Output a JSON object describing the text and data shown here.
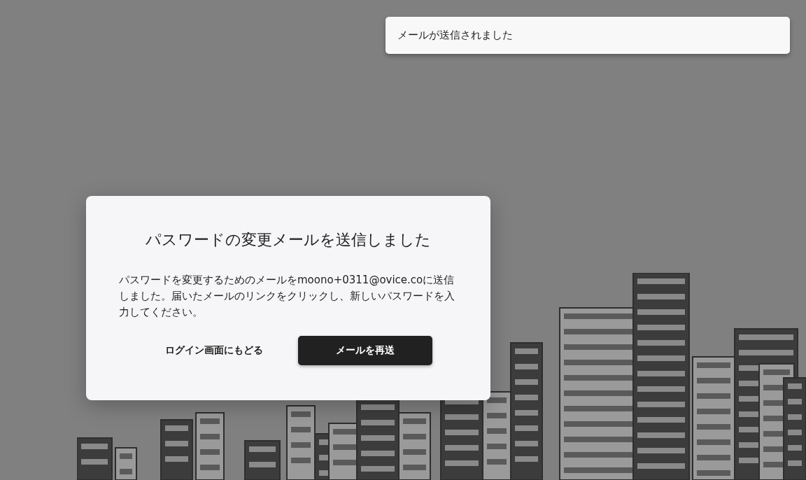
{
  "toast": {
    "message": "メールが送信されました"
  },
  "dialog": {
    "title": "パスワードの変更メールを送信しました",
    "body": "パスワードを変更するためのメールをmoono+0311@ovice.coに送信しました。届いたメールのリンクをクリックし、新しいパスワードを入力してください。",
    "buttons": [
      {
        "kind": "text",
        "label": "ログイン画面にもどる"
      },
      {
        "kind": "primary",
        "label": "メールを再送"
      }
    ]
  }
}
